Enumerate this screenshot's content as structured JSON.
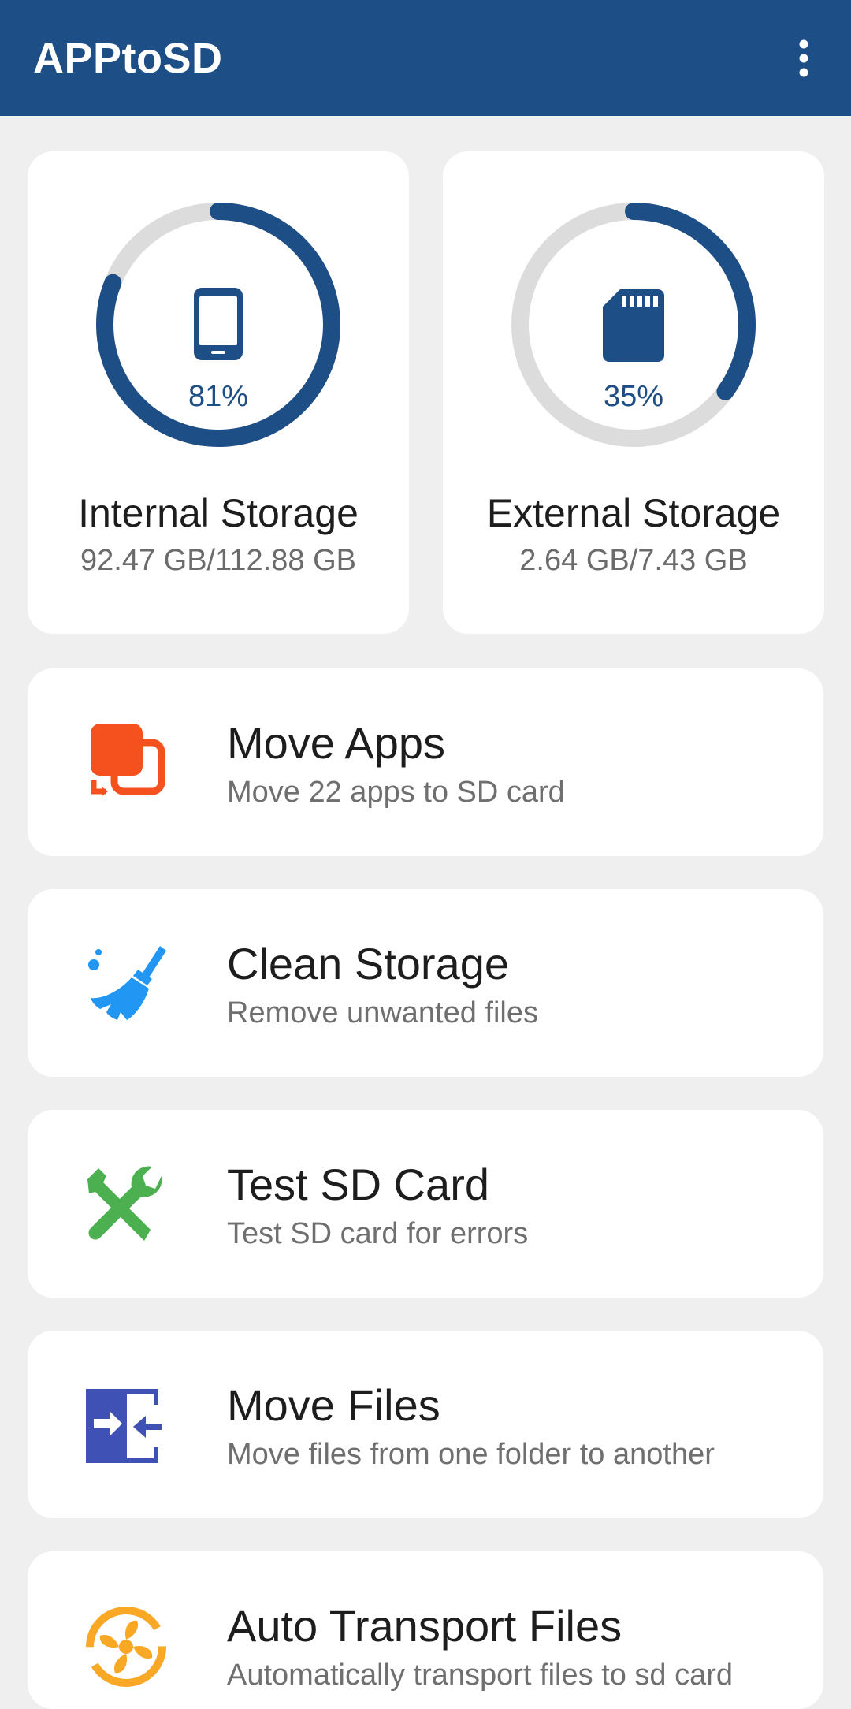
{
  "appbar": {
    "title": "APPtoSD",
    "menu_icon": "more-vert-icon"
  },
  "storage": {
    "internal": {
      "icon": "phone-icon",
      "percent_label": "81%",
      "percent": 81,
      "label": "Internal Storage",
      "size": "92.47 GB/112.88 GB"
    },
    "external": {
      "icon": "sd-card-icon",
      "percent_label": "35%",
      "percent": 35,
      "label": "External Storage",
      "size": "2.64 GB/7.43 GB"
    }
  },
  "features": [
    {
      "icon": "move-apps-icon",
      "title": "Move Apps",
      "subtitle": "Move 22 apps to SD card",
      "color": "#f4511e"
    },
    {
      "icon": "broom-icon",
      "title": "Clean Storage",
      "subtitle": "Remove unwanted files",
      "color": "#2196f3"
    },
    {
      "icon": "tools-icon",
      "title": "Test SD Card",
      "subtitle": "Test SD card for errors",
      "color": "#4caf50"
    },
    {
      "icon": "move-files-icon",
      "title": "Move Files",
      "subtitle": "Move files from one folder to another",
      "color": "#3f51b5"
    },
    {
      "icon": "fan-icon",
      "title": "Auto Transport Files",
      "subtitle": "Automatically transport files to sd card",
      "color": "#f9a825"
    }
  ],
  "colors": {
    "primary": "#1e4e86",
    "ring_track": "#dcdcdc",
    "background": "#efefef"
  }
}
